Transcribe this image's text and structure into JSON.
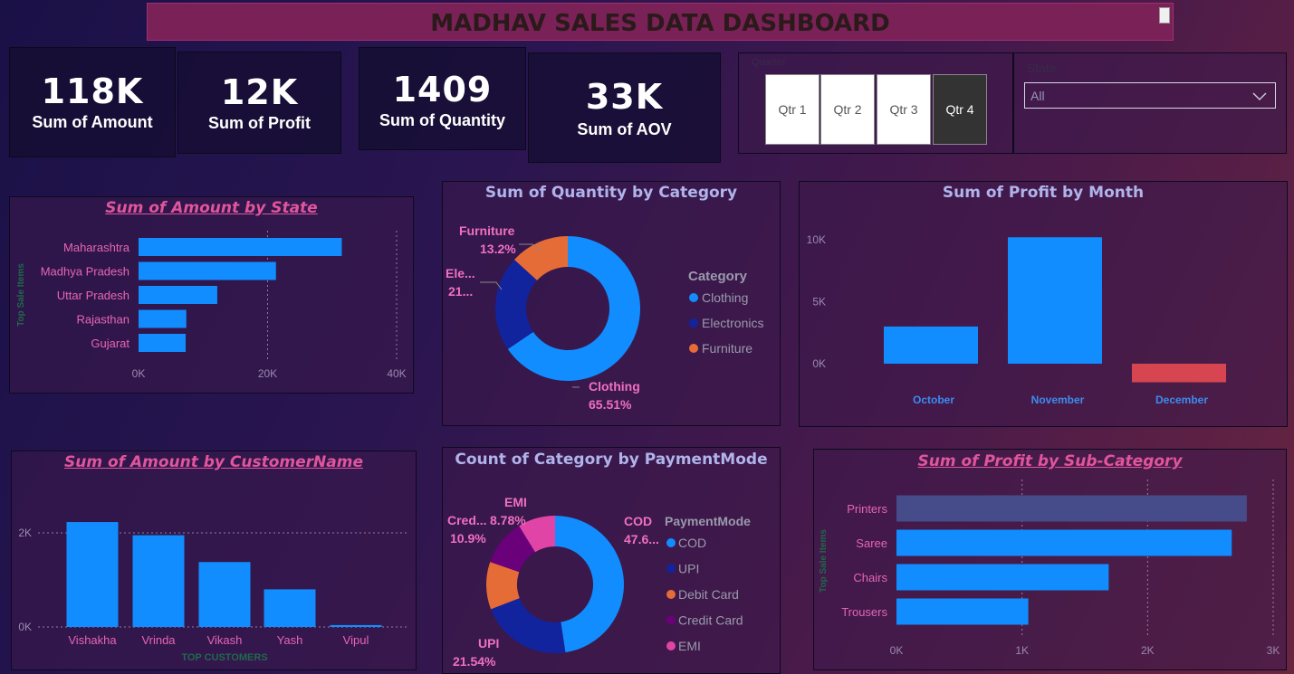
{
  "header": {
    "title": "MADHAV SALES DATA DASHBOARD"
  },
  "kpis": [
    {
      "value": "118K",
      "label": "Sum of Amount"
    },
    {
      "value": "12K",
      "label": "Sum of Profit"
    },
    {
      "value": "1409",
      "label": "Sum of Quantity"
    },
    {
      "value": "33K",
      "label": "Sum of AOV"
    }
  ],
  "quarter_slicer": {
    "label": "Quarter",
    "options": [
      "Qtr 1",
      "Qtr 2",
      "Qtr 3",
      "Qtr 4"
    ],
    "selected": "Qtr 4"
  },
  "state_slicer": {
    "label": "State",
    "value": "All"
  },
  "colors": {
    "accent": "#118dff",
    "navy": "#12239e",
    "orange": "#e66c37",
    "purple": "#6b007b",
    "pink": "#e044a7",
    "red": "#d64550",
    "greyblue": "#464b8a",
    "title_pink": "#e0559c"
  },
  "chart_data": [
    {
      "id": "amount_by_state",
      "type": "bar",
      "orientation": "horizontal",
      "title": "Sum of Amount by State",
      "ylabel": "Top Sale Items",
      "categories": [
        "Maharashtra",
        "Madhya Pradesh",
        "Uttar Pradesh",
        "Rajasthan",
        "Gujarat"
      ],
      "values": [
        31500,
        21300,
        12200,
        7400,
        7300
      ],
      "xlim": [
        0,
        40000
      ],
      "ticks": [
        "0K",
        "20K",
        "40K"
      ]
    },
    {
      "id": "quantity_by_category",
      "type": "pie",
      "donut": true,
      "title": "Sum of Quantity by Category",
      "legend_title": "Category",
      "categories": [
        "Clothing",
        "Electronics",
        "Furniture"
      ],
      "values": [
        65.51,
        21.29,
        13.2
      ],
      "data_labels": [
        {
          "name": "Clothing",
          "pct": "65.51%"
        },
        {
          "name": "Ele...",
          "pct": "21..."
        },
        {
          "name": "Furniture",
          "pct": "13.2%"
        }
      ]
    },
    {
      "id": "profit_by_month",
      "type": "bar",
      "title": "Sum of Profit by Month",
      "categories": [
        "October",
        "November",
        "December"
      ],
      "values": [
        3000,
        10200,
        -1500
      ],
      "ylim": [
        -2000,
        11000
      ],
      "ticks": [
        "0K",
        "5K",
        "10K"
      ]
    },
    {
      "id": "amount_by_customer",
      "type": "bar",
      "title": "Sum of Amount by CustomerName",
      "xlabel": "TOP CUSTOMERS",
      "categories": [
        "Vishakha",
        "Vrinda",
        "Vikash",
        "Yash",
        "Vipul"
      ],
      "values": [
        2230,
        1950,
        1380,
        800,
        40
      ],
      "ylim": [
        0,
        2700
      ],
      "ticks": [
        "0K",
        "2K"
      ]
    },
    {
      "id": "category_by_paymentmode",
      "type": "pie",
      "donut": true,
      "title": "Count of Category by PaymentMode",
      "legend_title": "PaymentMode",
      "categories": [
        "COD",
        "UPI",
        "Debit Card",
        "Credit Card",
        "EMI"
      ],
      "values": [
        47.6,
        21.54,
        11.18,
        10.9,
        8.78
      ],
      "data_labels": [
        {
          "name": "COD",
          "pct": "47.6..."
        },
        {
          "name": "UPI",
          "pct": "21.54%"
        },
        {
          "name": "Cred...",
          "pct": "10.9%"
        },
        {
          "name": "EMI",
          "pct": "8.78%"
        }
      ]
    },
    {
      "id": "profit_by_subcategory",
      "type": "bar",
      "orientation": "horizontal",
      "title": "Sum of Profit by Sub-Category",
      "ylabel": "Top Sale Items",
      "categories": [
        "Printers",
        "Saree",
        "Chairs",
        "Trousers"
      ],
      "values": [
        2790,
        2670,
        1690,
        1050
      ],
      "xlim": [
        0,
        3000
      ],
      "ticks": [
        "0K",
        "1K",
        "2K",
        "3K"
      ]
    }
  ]
}
